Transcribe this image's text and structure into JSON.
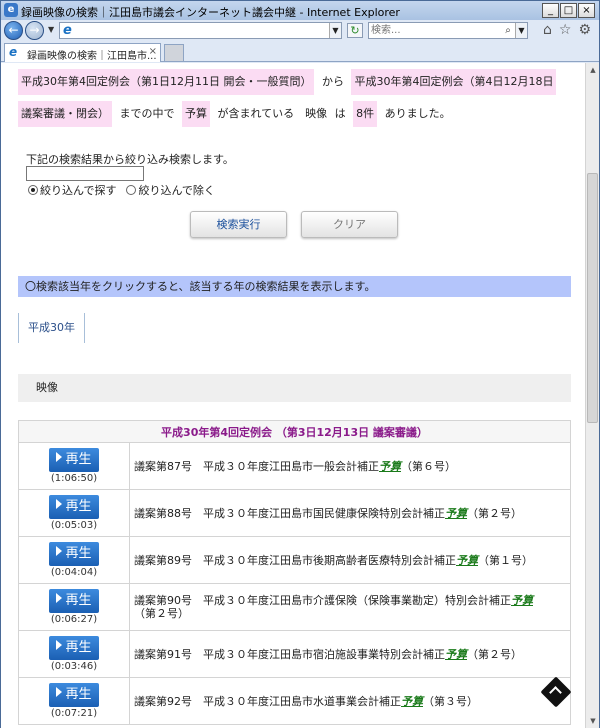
{
  "window": {
    "title": "録画映像の検索｜江田島市議会インターネット議会中継 - Internet Explorer",
    "controls": [
      "_",
      "□",
      "×"
    ]
  },
  "toolbar": {
    "search_placeholder": "検索..."
  },
  "tab": {
    "label": "録画映像の検索｜江田島市...",
    "close": "×"
  },
  "conditions": {
    "from_session": "平成30年第4回定例会（第1日12月11日 開会・一般質問）",
    "from_word": "から",
    "to_session": "平成30年第4回定例会（第4日12月18日",
    "to_session_cont": "議案審議・閉会）",
    "until_text": "までの中で",
    "keyword": "予算",
    "contains_text": "が含まれている　映像",
    "wa": "は",
    "count": "8件",
    "result_text": "ありました。"
  },
  "refine": {
    "label": "下記の検索結果から絞り込み検索します。",
    "input_value": "",
    "options": [
      "絞り込んで探す",
      "絞り込んで除く"
    ],
    "selected": 0
  },
  "buttons": {
    "search": "検索実行",
    "clear": "クリア"
  },
  "info": "〇検索該当年をクリックすると、該当する年の検索結果を表示します。",
  "year_tab": "平成30年",
  "section_label": "映像",
  "results": {
    "header": "平成30年第4回定例会 （第3日12月13日 議案審議）",
    "play_label": "再生",
    "rows": [
      {
        "duration": "(1:06:50)",
        "desc_before": "議案第87号　平成３０年度江田島市一般会計補正",
        "keyword": "予算",
        "desc_after": "（第６号）"
      },
      {
        "duration": "(0:05:03)",
        "desc_before": "議案第88号　平成３０年度江田島市国民健康保険特別会計補正",
        "keyword": "予算",
        "desc_after": "（第２号）"
      },
      {
        "duration": "(0:04:04)",
        "desc_before": "議案第89号　平成３０年度江田島市後期高齢者医療特別会計補正",
        "keyword": "予算",
        "desc_after": "（第１号）"
      },
      {
        "duration": "(0:06:27)",
        "desc_before": "議案第90号　平成３０年度江田島市介護保険（保険事業勘定）特別会計補正",
        "keyword": "予算",
        "desc_after": "（第２号）"
      },
      {
        "duration": "(0:03:46)",
        "desc_before": "議案第91号　平成３０年度江田島市宿泊施設事業特別会計補正",
        "keyword": "予算",
        "desc_after": "（第２号）"
      },
      {
        "duration": "(0:07:21)",
        "desc_before": "議案第92号　平成３０年度江田島市水道事業会計補正",
        "keyword": "予算",
        "desc_after": "（第３号）"
      }
    ]
  },
  "icons": {
    "home": "⌂",
    "favorites": "☆",
    "settings": "⚙"
  }
}
